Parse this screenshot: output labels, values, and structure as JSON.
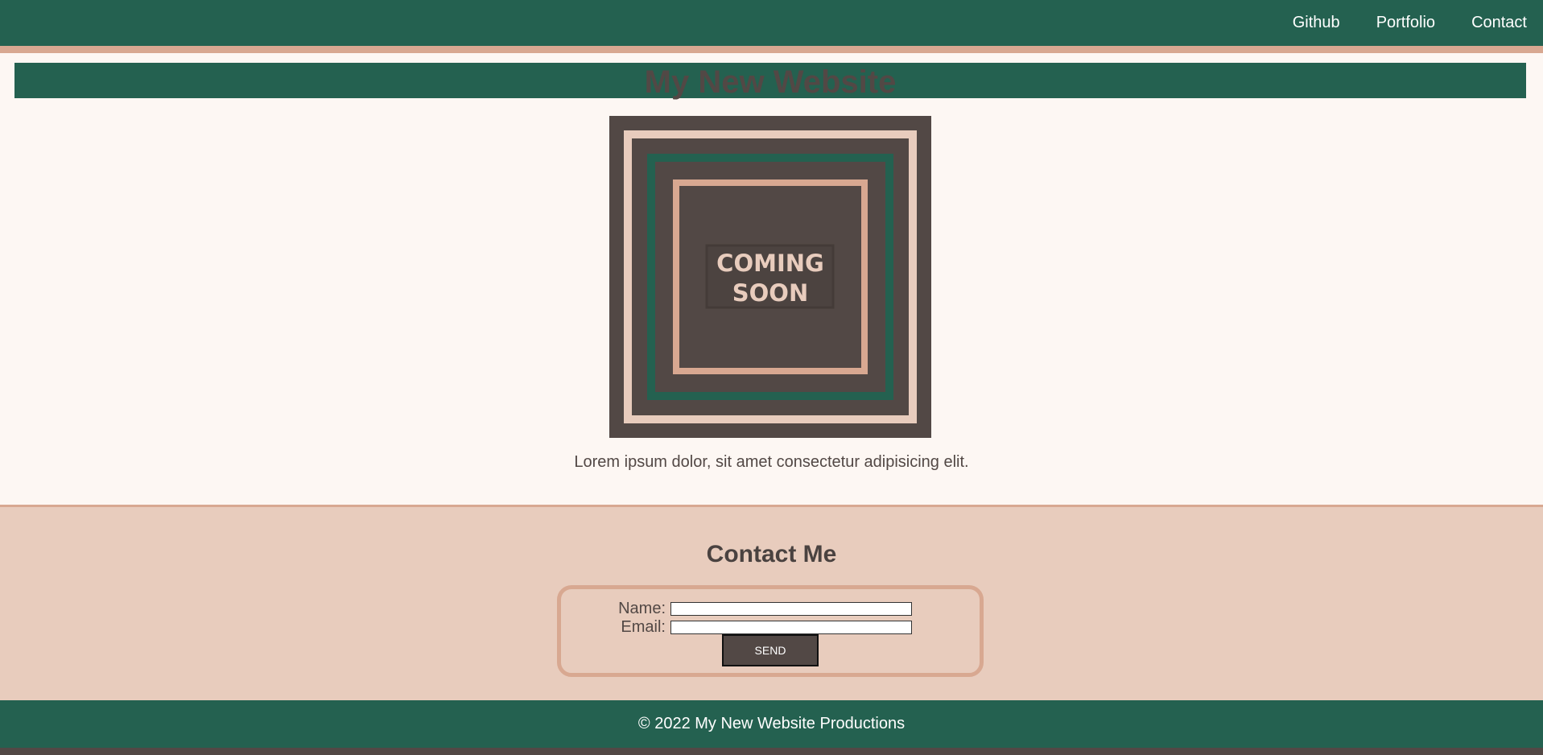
{
  "nav": {
    "links": [
      "Github",
      "Portfolio",
      "Contact"
    ]
  },
  "header": {
    "title": "My New Website"
  },
  "hero": {
    "image_text_line1": "COMING",
    "image_text_line2": "SOON"
  },
  "intro": {
    "text": "Lorem ipsum dolor, sit amet consectetur adipisicing elit."
  },
  "contact": {
    "heading": "Contact Me",
    "name_label": "Name:",
    "name_value": "",
    "email_label": "Email:",
    "email_value": "",
    "send_label": "SEND"
  },
  "footer": {
    "text": "© 2022 My New Website Productions"
  },
  "colors": {
    "primary_green": "#246150",
    "accent_tan": "#d8a891",
    "dark_brown": "#524845",
    "light_bg": "#fdf7f3",
    "contact_bg": "#e8ccbd"
  }
}
